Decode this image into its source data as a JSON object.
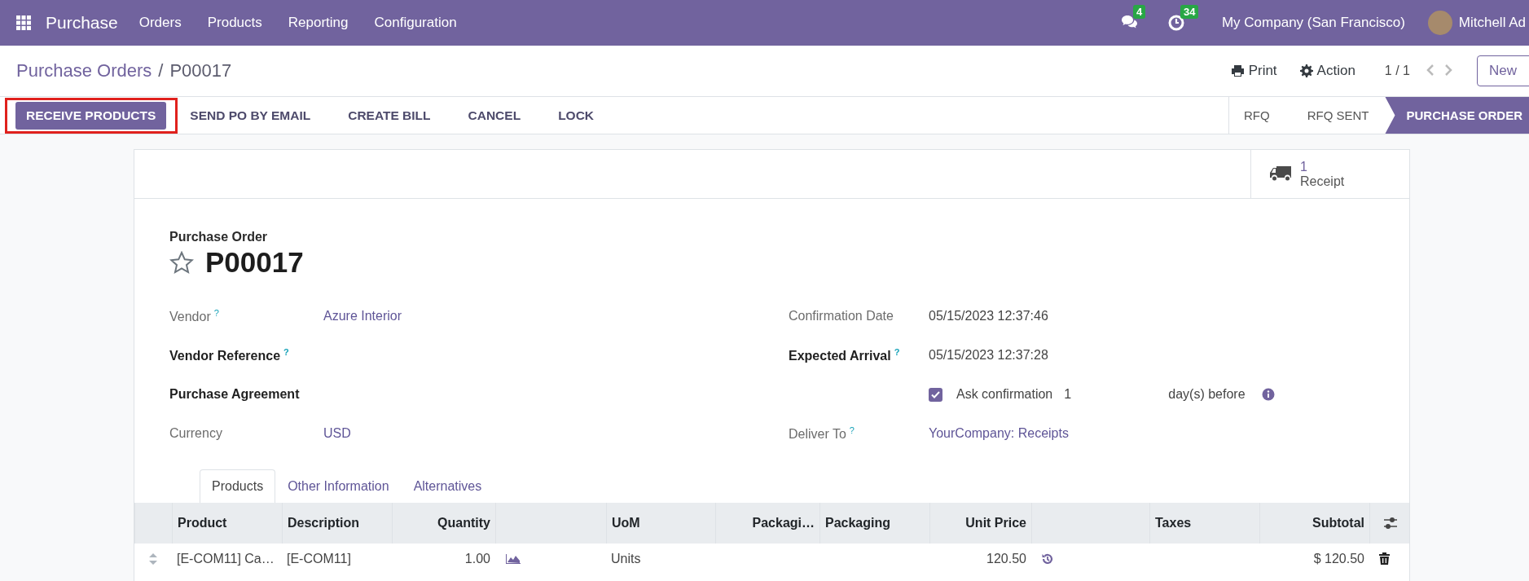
{
  "navbar": {
    "app_name": "Purchase",
    "menu": [
      "Orders",
      "Products",
      "Reporting",
      "Configuration"
    ],
    "messages_count": "4",
    "activities_count": "34",
    "company": "My Company (San Francisco)",
    "user": "Mitchell Ad"
  },
  "control_panel": {
    "breadcrumb_parent": "Purchase Orders",
    "breadcrumb_separator": "/",
    "breadcrumb_current": "P00017",
    "print": "Print",
    "action": "Action",
    "pager": "1 / 1",
    "new_button": "New"
  },
  "status_bar": {
    "buttons": [
      {
        "label": "RECEIVE PRODUCTS",
        "primary": true,
        "highlighted": true
      },
      {
        "label": "SEND PO BY EMAIL",
        "primary": false,
        "highlighted": false
      },
      {
        "label": "CREATE BILL",
        "primary": false,
        "highlighted": false
      },
      {
        "label": "CANCEL",
        "primary": false,
        "highlighted": false
      },
      {
        "label": "LOCK",
        "primary": false,
        "highlighted": false
      }
    ],
    "stages": [
      {
        "label": "RFQ",
        "selected": false
      },
      {
        "label": "RFQ SENT",
        "selected": false
      },
      {
        "label": "PURCHASE ORDER",
        "selected": true
      }
    ]
  },
  "smart_button": {
    "count": "1",
    "label": "Receipt"
  },
  "form": {
    "caption": "Purchase Order",
    "name": "P00017",
    "starred": false,
    "left_fields": [
      {
        "label": "Vendor",
        "help": "?",
        "required": false,
        "value": "Azure Interior",
        "link": true
      },
      {
        "label": "Vendor Reference",
        "help": "?",
        "required": true
      },
      {
        "label": "Purchase Agreement",
        "required": true
      },
      {
        "label": "Currency",
        "required": false,
        "value": "USD",
        "link": true
      }
    ],
    "right_fields": [
      {
        "kind": "field",
        "label": "Confirmation Date",
        "required": false,
        "value": "05/15/2023 12:37:46",
        "link": false
      },
      {
        "kind": "field",
        "label": "Expected Arrival",
        "help": "?",
        "required": true,
        "value": "05/15/2023 12:37:28",
        "link": false
      },
      {
        "kind": "checkbox",
        "checked": true,
        "label": "Ask confirmation",
        "value": "1",
        "suffix": "day(s) before"
      },
      {
        "kind": "field",
        "label": "Deliver To",
        "help": "?",
        "required": false,
        "value": "YourCompany: Receipts",
        "link": true
      }
    ]
  },
  "tabs": [
    {
      "label": "Products",
      "selected": true
    },
    {
      "label": "Other Information",
      "selected": false
    },
    {
      "label": "Alternatives",
      "selected": false
    }
  ],
  "table": {
    "columns": [
      {
        "kind": "text",
        "label": "Product"
      },
      {
        "kind": "text",
        "label": "Description"
      },
      {
        "kind": "number",
        "label": "Quantity"
      },
      {
        "kind": "icon"
      },
      {
        "kind": "text",
        "label": "UoM"
      },
      {
        "kind": "number",
        "label": "Packagi…"
      },
      {
        "kind": "text",
        "label": "Packaging"
      },
      {
        "kind": "number",
        "label": "Unit Price"
      },
      {
        "kind": "icon"
      },
      {
        "kind": "text",
        "label": "Taxes"
      },
      {
        "kind": "number",
        "label": "Subtotal"
      }
    ],
    "rows": [
      {
        "cells": [
          {
            "kind": "text",
            "text": "[E-COM11] Ca…"
          },
          {
            "kind": "text",
            "text": "[E-COM11]"
          },
          {
            "kind": "text",
            "text": "1.00"
          },
          {
            "kind": "chart"
          },
          {
            "kind": "text",
            "text": "Units"
          },
          {
            "kind": "blank"
          },
          {
            "kind": "blank"
          },
          {
            "kind": "text",
            "text": "120.50"
          },
          {
            "kind": "history"
          },
          {
            "kind": "blank"
          },
          {
            "kind": "text",
            "text": "$ 120.50"
          }
        ]
      }
    ]
  }
}
